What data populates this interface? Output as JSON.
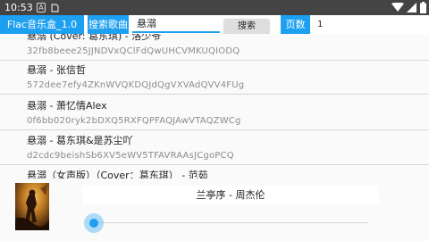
{
  "status_bar": {
    "time": "10:53",
    "icon_a": "A"
  },
  "header": {
    "app_title": "Flac音乐盒_1.0",
    "search_label": "搜索歌曲",
    "search_value": "悬溺",
    "search_button": "搜索",
    "page_label": "页数",
    "page_value": "1",
    "accent_color": "#1ea0f0"
  },
  "songs": [
    {
      "name": "悬溺 (Cover: 葛东琪) - 洛少爷",
      "id": "32fb8beee25JJNDVxQClFdQwUHCVMKUQIODQ"
    },
    {
      "name": "悬溺 - 张信哲",
      "id": "572dee7efy4ZKnWVQKDQJdQgVXVAdQVV4FUg"
    },
    {
      "name": "悬溺 - 萧忆情Alex",
      "id": "0f6bb020ryk2bDXQ5RXFQPFAQJAwVTAQZWCg"
    },
    {
      "name": "悬溺 - 葛东琪&是苏尘吖",
      "id": "d2cdc9beishSb6XV5eWV5TFAVRAAsJCgoPCQ"
    },
    {
      "name": "悬溺（女声版）（Cover：葛东琪） - 范茹",
      "id": ""
    }
  ],
  "player": {
    "now_playing": "兰亭序 - 周杰伦",
    "progress": 0.0
  }
}
